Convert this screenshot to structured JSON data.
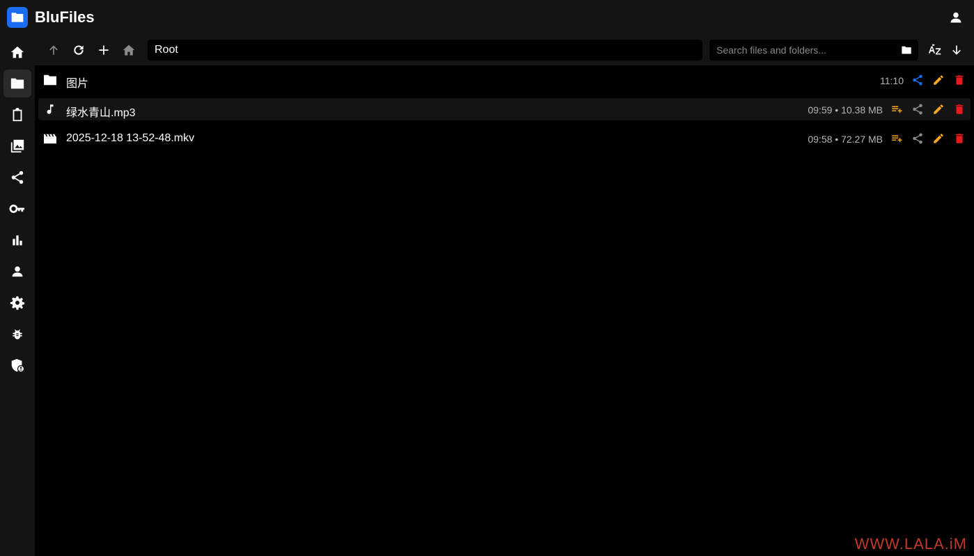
{
  "app": {
    "title": "BluFiles",
    "accent": "#1a6cf0"
  },
  "header": {
    "user_icon": "account-icon"
  },
  "sidebar": {
    "items": [
      {
        "icon": "home-icon",
        "active": false
      },
      {
        "icon": "folder-icon",
        "active": true
      },
      {
        "icon": "clipboard-icon",
        "active": false
      },
      {
        "icon": "photo-library-icon",
        "active": false
      },
      {
        "icon": "share-icon",
        "active": false
      },
      {
        "icon": "key-icon",
        "active": false
      },
      {
        "icon": "bar-chart-icon",
        "active": false
      },
      {
        "icon": "person-icon",
        "active": false
      },
      {
        "icon": "settings-icon",
        "active": false
      },
      {
        "icon": "bug-icon",
        "active": false
      },
      {
        "icon": "admin-shield-icon",
        "active": false
      }
    ]
  },
  "toolbar": {
    "path": "Root",
    "search_placeholder": "Search files and folders...",
    "buttons": [
      "arrow-up-icon",
      "refresh-icon",
      "add-icon",
      "home-icon"
    ],
    "sort_icon": "sort-az-icon",
    "order_icon": "arrow-down-icon"
  },
  "files": [
    {
      "name": "图片",
      "type": "folder",
      "meta": "11:10",
      "share_color": "#1a6cf0",
      "has_playlist": false,
      "highlighted": false
    },
    {
      "name": "绿水青山.mp3",
      "type": "audio",
      "meta": "09:59 • 10.38 MB",
      "share_color": "#8a8a8a",
      "has_playlist": true,
      "highlighted": true
    },
    {
      "name": "2025-12-18 13-52-48.mkv",
      "type": "video",
      "meta": "09:58 • 72.27 MB",
      "share_color": "#8a8a8a",
      "has_playlist": true,
      "highlighted": false
    }
  ],
  "colors": {
    "edit": "#f5a623",
    "delete": "#e8191c",
    "playlist": "#f5a623"
  },
  "watermark": "WWW.LALA.iM"
}
